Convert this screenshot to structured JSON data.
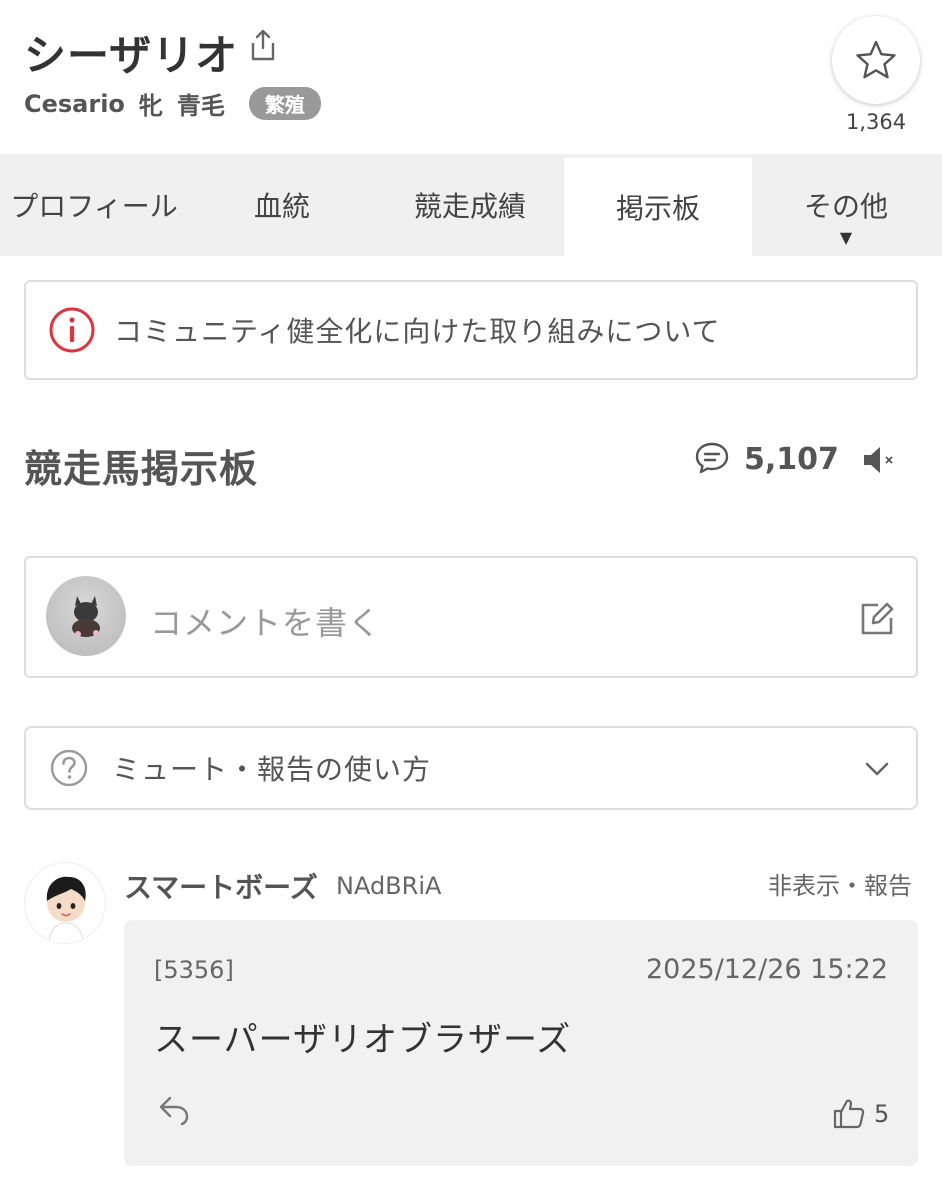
{
  "horse": {
    "name": "シーザリオ",
    "name_en": "Cesario",
    "sex": "牝",
    "coat": "青毛",
    "status_badge": "繁殖",
    "favorite_count": "1,364"
  },
  "icons": {
    "share": "share-icon",
    "favorite": "star-icon",
    "notice": "info-icon",
    "comments": "comment-bubble-icon",
    "mute": "speaker-mute-icon",
    "edit": "edit-icon",
    "help": "question-icon",
    "expand": "chevron-down-icon",
    "reply": "reply-icon",
    "like": "thumbs-up-icon"
  },
  "tabs": [
    {
      "label": "プロフィール",
      "active": false
    },
    {
      "label": "血統",
      "active": false
    },
    {
      "label": "競走成績",
      "active": false
    },
    {
      "label": "掲示板",
      "active": true
    },
    {
      "label": "その他",
      "active": false,
      "caret": "▼"
    }
  ],
  "notice": {
    "text": "コミュニティ健全化に向けた取り組みについて"
  },
  "board": {
    "title": "競走馬掲示板",
    "comment_count": "5,107"
  },
  "compose": {
    "placeholder": "コメントを書く"
  },
  "help": {
    "label": "ミュート・報告の使い方"
  },
  "posts": [
    {
      "username": "スマートボーズ",
      "user_id": "NAdBRiA",
      "actions": "非表示・報告",
      "number": "[5356]",
      "date": "2025/12/26 15:22",
      "body": "スーパーザリオブラザーズ",
      "likes": "5"
    }
  ],
  "colors": {
    "accent_red": "#d9363e",
    "tab_bg": "#f0f0f0",
    "border": "#dddddd",
    "post_bg": "#f1f1f1"
  }
}
